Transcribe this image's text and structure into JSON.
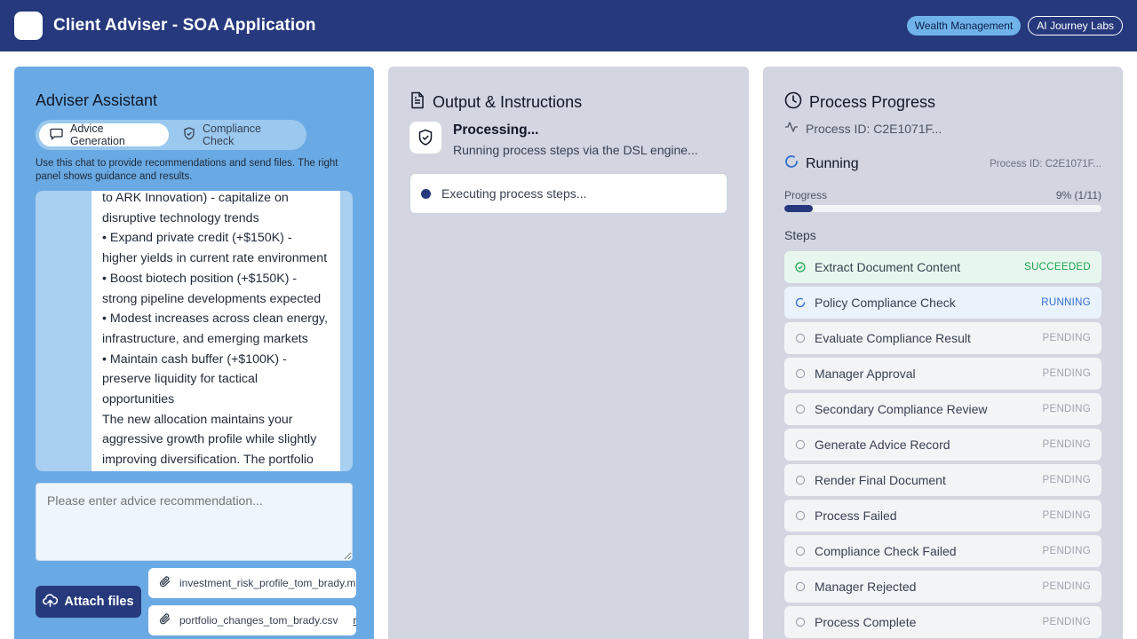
{
  "header": {
    "title": "Client Adviser - SOA Application",
    "badges": [
      "Wealth Management",
      "AI Journey Labs"
    ]
  },
  "left_panel": {
    "title": "Adviser Assistant",
    "tabs": [
      {
        "label": "Advice Generation",
        "active": true
      },
      {
        "label": "Compliance Check",
        "active": false
      }
    ],
    "helper_text": "Use this chat to provide recommendations and send files. The right panel shows guidance and results.",
    "message_lines": [
      "to ARK Innovation) - capitalize on",
      "disruptive technology trends",
      "•  Expand private credit (+$150K) -",
      "higher yields in current rate environment",
      "•  Boost biotech position (+$150K) -",
      "strong pipeline developments expected",
      "•  Modest increases across clean energy,",
      "infrastructure, and emerging markets",
      "•  Maintain cash buffer (+$100K) -",
      "preserve liquidity for tactical",
      "opportunities",
      "The new allocation maintains your",
      "aggressive growth profile while slightly",
      "improving diversification. The portfolio"
    ],
    "input_placeholder": "Please enter advice recommendation...",
    "attach_label": "Attach files",
    "files": [
      {
        "name": "investment_risk_profile_tom_brady.md",
        "action": "remove"
      },
      {
        "name": "portfolio_changes_tom_brady.csv",
        "action": "remove"
      }
    ]
  },
  "middle_panel": {
    "title": "Output & Instructions",
    "processing_title": "Processing...",
    "processing_subtitle": "Running process steps via the DSL engine...",
    "executing_text": "Executing process steps..."
  },
  "right_panel": {
    "title": "Process Progress",
    "process_id_label": "Process ID: C2E1071F...",
    "status": "Running",
    "status_process_id": "Process ID: C2E1071F...",
    "progress_label": "Progress",
    "progress_value": "9% (1/11)",
    "progress_fraction": 0.09,
    "steps_label": "Steps",
    "steps": [
      {
        "name": "Extract Document Content",
        "status": "SUCCEEDED"
      },
      {
        "name": "Policy Compliance Check",
        "status": "RUNNING"
      },
      {
        "name": "Evaluate Compliance Result",
        "status": "PENDING"
      },
      {
        "name": "Manager Approval",
        "status": "PENDING"
      },
      {
        "name": "Secondary Compliance Review",
        "status": "PENDING"
      },
      {
        "name": "Generate Advice Record",
        "status": "PENDING"
      },
      {
        "name": "Render Final Document",
        "status": "PENDING"
      },
      {
        "name": "Process Failed",
        "status": "PENDING"
      },
      {
        "name": "Compliance Check Failed",
        "status": "PENDING"
      },
      {
        "name": "Manager Rejected",
        "status": "PENDING"
      },
      {
        "name": "Process Complete",
        "status": "PENDING"
      }
    ]
  },
  "colors": {
    "header_bg": "#27397d",
    "left_panel_bg": "#6aaae4",
    "panel_bg": "#d3d5e1",
    "accent": "#27397d",
    "success": "#16a34a",
    "running": "#2f6fd0"
  },
  "icons": {
    "tab_advice": "chat-bubble-icon",
    "tab_compliance": "shield-check-icon",
    "attach": "cloud-upload-icon",
    "file": "paperclip-icon",
    "output": "document-icon",
    "progress": "clock-icon",
    "activity": "activity-icon",
    "status": "spinner-icon"
  }
}
